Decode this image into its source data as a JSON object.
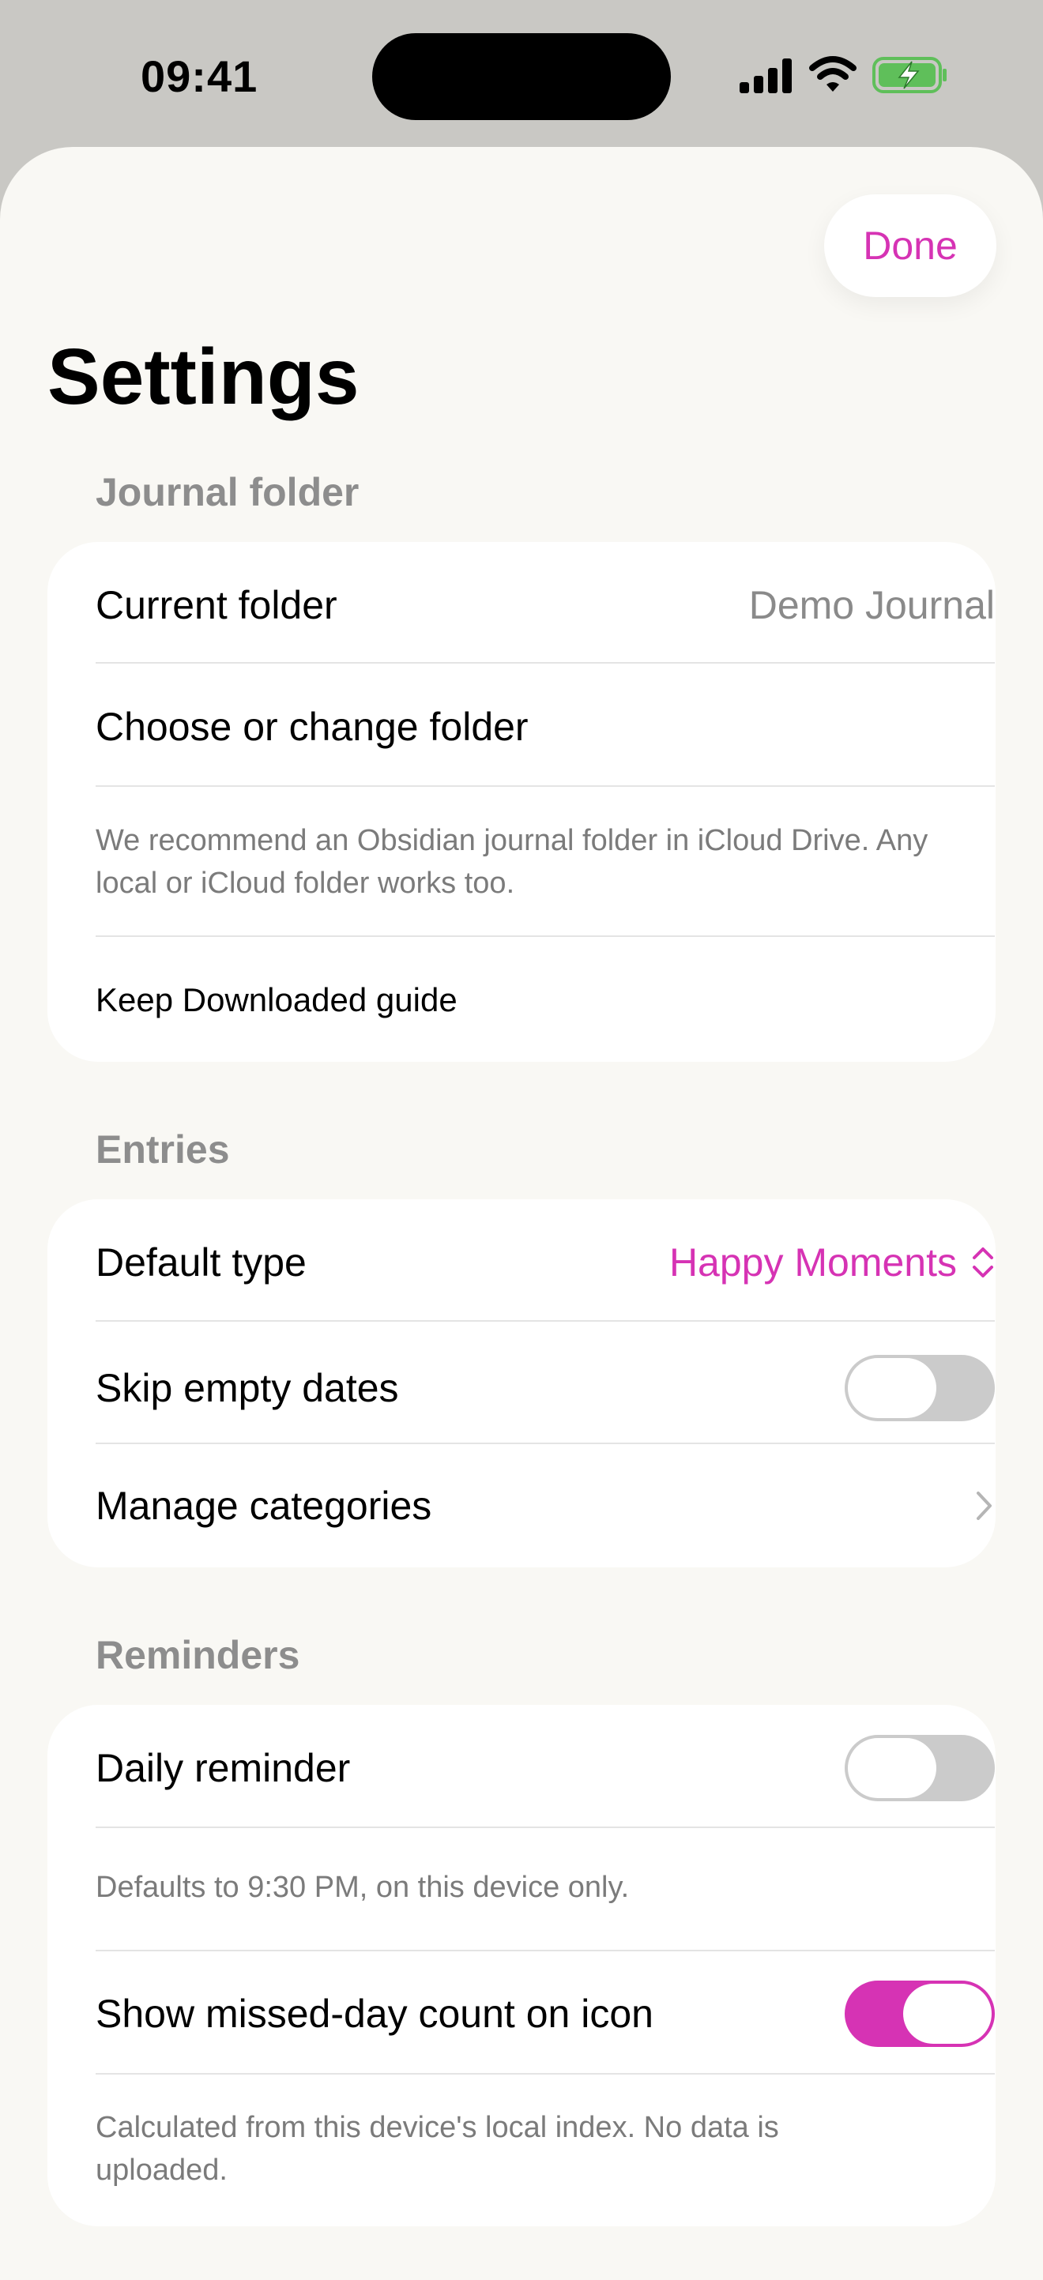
{
  "status": {
    "time": "09:41"
  },
  "header": {
    "done_label": "Done",
    "title": "Settings"
  },
  "journal_folder": {
    "heading": "Journal folder",
    "current_folder_label": "Current folder",
    "current_folder_value": "Demo Journal",
    "choose_label": "Choose or change folder",
    "note": "We recommend an Obsidian journal folder in iCloud Drive. Any local or iCloud folder works too.",
    "guide_label": "Keep Downloaded guide"
  },
  "entries": {
    "heading": "Entries",
    "default_type_label": "Default type",
    "default_type_value": "Happy Moments",
    "skip_empty_label": "Skip empty dates",
    "skip_empty_on": false,
    "manage_categories_label": "Manage categories"
  },
  "reminders": {
    "heading": "Reminders",
    "daily_label": "Daily reminder",
    "daily_on": false,
    "daily_note": "Defaults to 9:30 PM, on this device only.",
    "missed_label": "Show missed-day count on icon",
    "missed_on": true,
    "missed_note": "Calculated from this device's local index. No data is uploaded."
  },
  "colors": {
    "accent": "#d633b4",
    "sheet": "#f9f8f4",
    "toggle_off": "#cbcbcb"
  }
}
